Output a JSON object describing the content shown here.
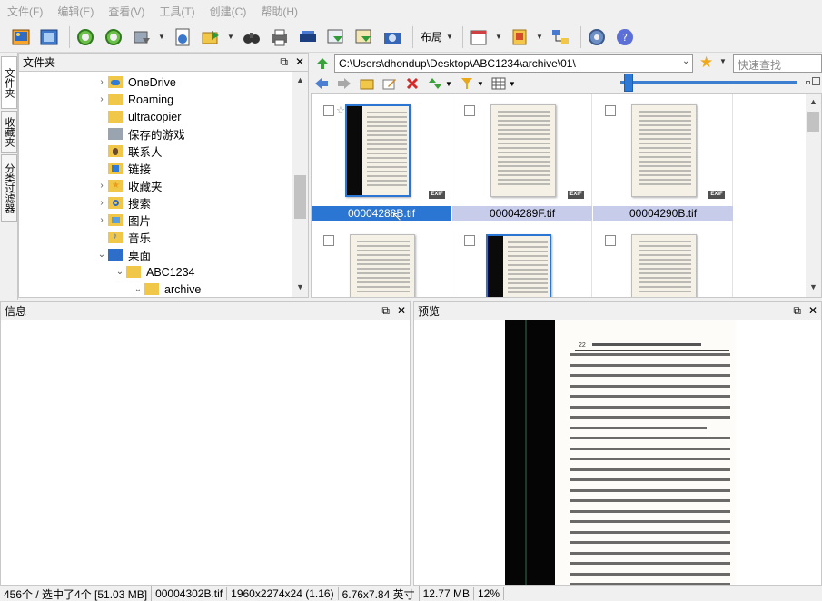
{
  "menu": [
    "文件(F)",
    "编辑(E)",
    "查看(V)",
    "工具(T)",
    "创建(C)",
    "帮助(H)"
  ],
  "toolbar": {
    "layout_label": "布局"
  },
  "side_tabs": [
    "文件夹",
    "收藏夹",
    "分类过滤器"
  ],
  "folder_panel": {
    "title": "文件夹"
  },
  "tree": [
    {
      "label": "OneDrive"
    },
    {
      "label": "Roaming"
    },
    {
      "label": "ultracopier"
    },
    {
      "label": "保存的游戏"
    },
    {
      "label": "联系人"
    },
    {
      "label": "链接"
    },
    {
      "label": "收藏夹"
    },
    {
      "label": "搜索"
    },
    {
      "label": "图片"
    },
    {
      "label": "音乐"
    },
    {
      "label": "桌面"
    },
    {
      "label": "ABC1234"
    },
    {
      "label": "archive"
    }
  ],
  "address": {
    "path": "C:\\Users\\dhondup\\Desktop\\ABC1234\\archive\\01\\",
    "quick_search_placeholder": "快速查找"
  },
  "files": [
    {
      "name": "00004288B.tif",
      "exif": "EXIF"
    },
    {
      "name": "00004289F.tif",
      "exif": "EXIF"
    },
    {
      "name": "00004290B.tif",
      "exif": "EXIF"
    }
  ],
  "info_panel": {
    "title": "信息"
  },
  "preview_panel": {
    "title": "预览",
    "page_number": "22"
  },
  "status": {
    "count": "456个 / 选中了4个 [51.03 MB]",
    "file": "00004302B.tif",
    "dims": "1960x2274x24 (1.16)",
    "print_size": "6.76x7.84 英寸",
    "size": "12.77 MB",
    "zoom": "12%"
  },
  "colors": {
    "selection": "#2a76d2",
    "row_highlight": "#c6ccea",
    "accent": "#2e78d6"
  }
}
